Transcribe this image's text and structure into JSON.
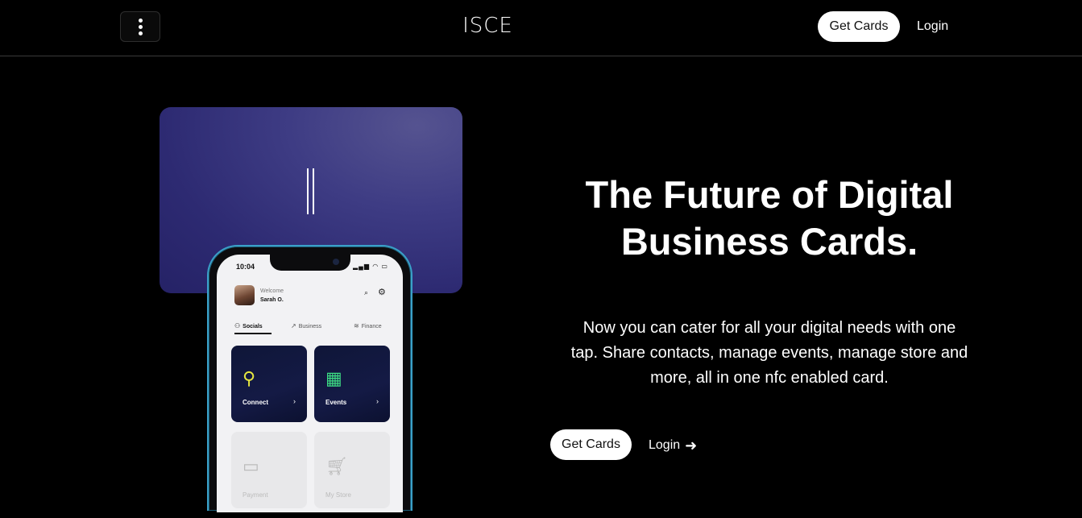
{
  "header": {
    "menu_icon": "vertical-dots-icon",
    "logo": "ISCE",
    "get_cards": "Get Cards",
    "login": "Login"
  },
  "hero": {
    "title_line1": "The Future of Digital",
    "title_line2": "Business Cards.",
    "desc_line1": "Now you can cater for all your digital needs with one",
    "desc_line2": "tap. Share contacts, manage events, manage store and",
    "desc_line3": "more, all in one nfc enabled card.",
    "get_cards": "Get Cards",
    "login": "Login",
    "login_icon": "arrow-right-icon"
  },
  "phone": {
    "time": "10:04",
    "welcome": "Welcome",
    "user_name": "Sarah O.",
    "tabs": [
      {
        "label": "Socials",
        "icon": "user-plus-icon",
        "active": true
      },
      {
        "label": "Business",
        "icon": "chart-icon",
        "active": false
      },
      {
        "label": "Finance",
        "icon": "coins-icon",
        "active": false
      }
    ],
    "tiles": [
      {
        "label": "Connect",
        "icon": "contact-list-icon",
        "color": "#e6e640"
      },
      {
        "label": "Events",
        "icon": "calendar-icon",
        "color": "#3ddc84"
      },
      {
        "label": "Payment",
        "icon": "card-icon"
      },
      {
        "label": "My Store",
        "icon": "cart-plus-icon"
      }
    ]
  },
  "colors": {
    "background": "#000000",
    "card": "#3e3c84",
    "phone_frame": "#3aa0c8",
    "button_bg": "#ffffff"
  }
}
